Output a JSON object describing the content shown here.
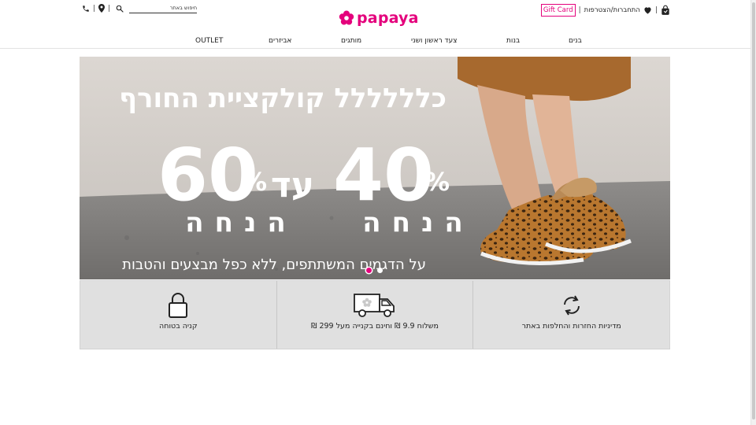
{
  "header": {
    "search_placeholder": "חיפוש באתר",
    "gift_card_label": "Gift Card",
    "account_label": "התחברות/הצטרפות",
    "divider": "|",
    "logo_text": "papaya",
    "icons": [
      "phone-icon",
      "location-pin-icon",
      "search-icon",
      "heart-icon",
      "shopping-bag-icon"
    ]
  },
  "nav": {
    "items": [
      "בנים",
      "בנות",
      "צעד ראשון ושני",
      "מותגים",
      "אביזרים",
      "OUTLET"
    ]
  },
  "hero": {
    "headline": "כלללללל קולקציית החורף",
    "left_percent": "60",
    "mid_word": "עד",
    "right_percent": "40",
    "percent_sign": "%",
    "discount_word": "הנחה",
    "fineprint": "על הדגמים המשתתפים, ללא כפל מבצעים והטבות",
    "slides_total": 2,
    "active_slide": 1
  },
  "features": [
    {
      "label": "מדיניות החזרות והחלפות באתר",
      "icon": "refresh-arrows-icon"
    },
    {
      "label": "משלוח 9.9 ₪ וחינם בקנייה מעל 299 ₪",
      "icon": "delivery-truck-icon"
    },
    {
      "label": "קניה בטוחה",
      "icon": "padlock-icon"
    }
  ],
  "colors": {
    "brand": "#e4007c",
    "feature_bg": "#e0e0e0"
  }
}
